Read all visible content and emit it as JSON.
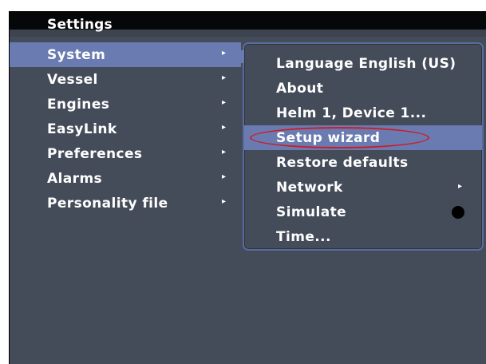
{
  "title": "Settings",
  "main_menu": [
    {
      "label": "System",
      "selected": true,
      "arrow": "▸"
    },
    {
      "label": "Vessel",
      "selected": false,
      "arrow": "▸"
    },
    {
      "label": "Engines",
      "selected": false,
      "arrow": "▸"
    },
    {
      "label": "EasyLink",
      "selected": false,
      "arrow": "▸"
    },
    {
      "label": "Preferences",
      "selected": false,
      "arrow": "▸"
    },
    {
      "label": "Alarms",
      "selected": false,
      "arrow": "▸"
    },
    {
      "label": "Personality file",
      "selected": false,
      "arrow": "▸"
    }
  ],
  "submenu": [
    {
      "label": "Language English (US)"
    },
    {
      "label": "About"
    },
    {
      "label": "Helm 1, Device 1..."
    },
    {
      "label": "Setup wizard",
      "highlight": true,
      "circled": true
    },
    {
      "label": "Restore defaults"
    },
    {
      "label": "Network",
      "arrow": "▸"
    },
    {
      "label": "Simulate",
      "indicator": "filled-dot"
    },
    {
      "label": "Time..."
    }
  ],
  "colors": {
    "background": "#444b59",
    "highlight": "#6a7bb1",
    "annotation": "#c8202a"
  }
}
